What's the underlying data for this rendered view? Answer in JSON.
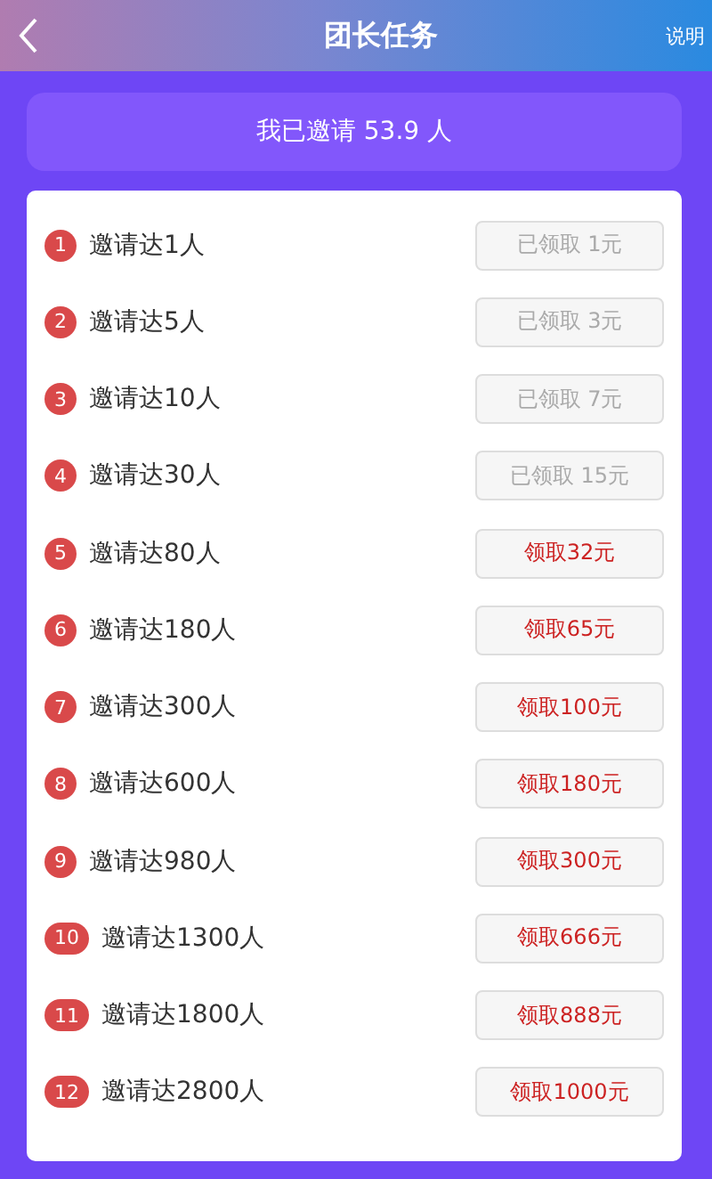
{
  "header": {
    "title": "团长任务",
    "help": "说明"
  },
  "summary": "我已邀请 53.9 人",
  "tasks": [
    {
      "number": "1",
      "label": "邀请达1人",
      "button": "已领取 1元",
      "claimed": true
    },
    {
      "number": "2",
      "label": "邀请达5人",
      "button": "已领取 3元",
      "claimed": true
    },
    {
      "number": "3",
      "label": "邀请达10人",
      "button": "已领取 7元",
      "claimed": true
    },
    {
      "number": "4",
      "label": "邀请达30人",
      "button": "已领取 15元",
      "claimed": true
    },
    {
      "number": "5",
      "label": "邀请达80人",
      "button": "领取32元",
      "claimed": false
    },
    {
      "number": "6",
      "label": "邀请达180人",
      "button": "领取65元",
      "claimed": false
    },
    {
      "number": "7",
      "label": "邀请达300人",
      "button": "领取100元",
      "claimed": false
    },
    {
      "number": "8",
      "label": "邀请达600人",
      "button": "领取180元",
      "claimed": false
    },
    {
      "number": "9",
      "label": "邀请达980人",
      "button": "领取300元",
      "claimed": false
    },
    {
      "number": "10",
      "label": "邀请达1300人",
      "button": "领取666元",
      "claimed": false
    },
    {
      "number": "11",
      "label": "邀请达1800人",
      "button": "领取888元",
      "claimed": false
    },
    {
      "number": "12",
      "label": "邀请达2800人",
      "button": "领取1000元",
      "claimed": false
    }
  ]
}
